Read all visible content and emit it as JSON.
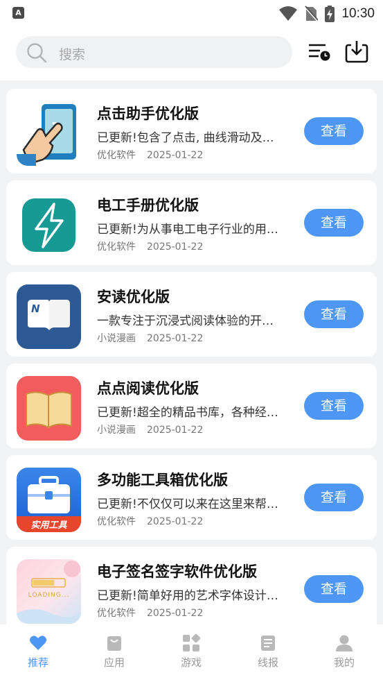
{
  "status_bar": {
    "time": "10:30",
    "left_badge": "A"
  },
  "header": {
    "search_placeholder": "搜索"
  },
  "apps": [
    {
      "title": "点击助手优化版",
      "desc": "已更新!包含了点击, 曲线滑动及…",
      "category": "优化软件",
      "date": "2025-01-22",
      "button": "查看",
      "icon": "tap-hand-icon"
    },
    {
      "title": "电工手册优化版",
      "desc": "已更新!为从事电工电子行业的用…",
      "category": "优化软件",
      "date": "2025-01-22",
      "button": "查看",
      "icon": "lightning-icon"
    },
    {
      "title": "安读优化版",
      "desc": "一款专注于沉浸式阅读体验的开…",
      "category": "小说漫画",
      "date": "2025-01-22",
      "button": "查看",
      "icon": "book-n-icon"
    },
    {
      "title": "点点阅读优化版",
      "desc": "已更新!超全的精品书库，各种经…",
      "category": "小说漫画",
      "date": "2025-01-22",
      "button": "查看",
      "icon": "open-book-icon"
    },
    {
      "title": "多功能工具箱优化版",
      "desc": "已更新!不仅仅可以来在这里来帮…",
      "category": "优化软件",
      "date": "2025-01-22",
      "button": "查看",
      "icon": "toolbox-icon",
      "icon_label": "实用工具"
    },
    {
      "title": "电子签名签字软件优化版",
      "desc": "已更新!简单好用的艺术字体设计…",
      "category": "优化软件",
      "date": "2025-01-22",
      "button": "查看",
      "icon": "loading-art-icon",
      "icon_label": "LOADING..."
    }
  ],
  "tabs": [
    {
      "label": "推荐",
      "icon": "heart-icon",
      "active": true
    },
    {
      "label": "应用",
      "icon": "bag-icon",
      "active": false
    },
    {
      "label": "游戏",
      "icon": "grid-icon",
      "active": false
    },
    {
      "label": "线报",
      "icon": "news-icon",
      "active": false
    },
    {
      "label": "我的",
      "icon": "user-icon",
      "active": false
    }
  ],
  "colors": {
    "accent": "#4d96f2",
    "background": "#f2f3f5"
  }
}
